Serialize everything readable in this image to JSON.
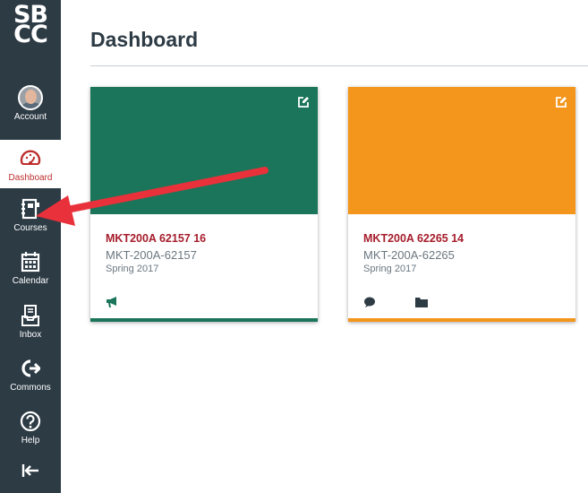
{
  "colors": {
    "sidebar": "#2d3b45",
    "active_label": "#bd2e2e",
    "course_title": "#a61d2c",
    "muted_text": "#6b7780",
    "annotation_arrow": "#e8313a"
  },
  "logo": {
    "line1": "SB",
    "line2": "CC"
  },
  "nav": {
    "account": {
      "label": "Account",
      "icon": "user-avatar"
    },
    "dashboard": {
      "label": "Dashboard",
      "icon": "speedometer-icon"
    },
    "courses": {
      "label": "Courses",
      "icon": "courses-icon"
    },
    "calendar": {
      "label": "Calendar",
      "icon": "calendar-icon"
    },
    "inbox": {
      "label": "Inbox",
      "icon": "inbox-icon"
    },
    "commons": {
      "label": "Commons",
      "icon": "commons-icon"
    },
    "help": {
      "label": "Help",
      "icon": "help-icon"
    },
    "collapse": {
      "icon": "collapse-arrow-icon"
    }
  },
  "page": {
    "title": "Dashboard"
  },
  "cards": [
    {
      "title": "MKT200A 62157 16",
      "code": "MKT-200A-62157",
      "term": "Spring 2017",
      "color": "#1a755a",
      "actions": [
        "announcements-icon"
      ]
    },
    {
      "title": "MKT200A 62265 14",
      "code": "MKT-200A-62265",
      "term": "Spring 2017",
      "color": "#f4951c",
      "actions": [
        "discussions-icon",
        "files-icon"
      ]
    }
  ]
}
